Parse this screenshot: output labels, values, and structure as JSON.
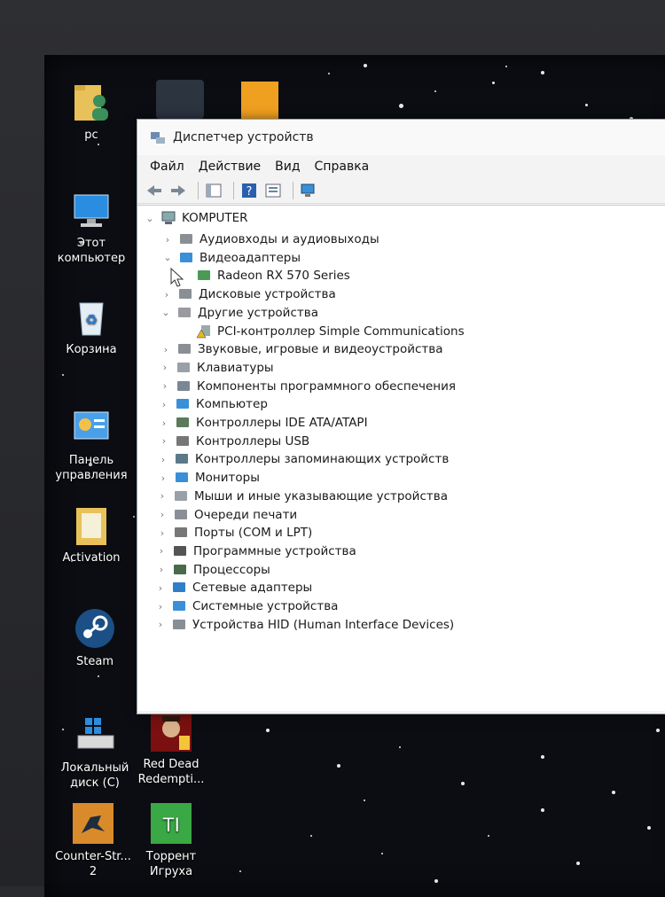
{
  "desktop": {
    "icons": [
      {
        "name": "pc-folder-icon",
        "label": "pc"
      },
      {
        "name": "computer-icon",
        "label": "Этот компьютер"
      },
      {
        "name": "recycle-bin-icon",
        "label": "Корзина"
      },
      {
        "name": "control-panel-icon",
        "label": "Панель управления"
      },
      {
        "name": "activation-folder-icon",
        "label": "Activation"
      },
      {
        "name": "steam-icon",
        "label": "Steam"
      },
      {
        "name": "local-disk-icon",
        "label": "Локальный диск (C)"
      },
      {
        "name": "red-dead-icon",
        "label": "Red Dead Redempti..."
      },
      {
        "name": "counter-strike-icon",
        "label": "Counter-Str... 2"
      },
      {
        "name": "torrent-icon",
        "label": "Торрент Игруха"
      }
    ]
  },
  "window": {
    "title": "Диспетчер устройств",
    "menu": [
      "Файл",
      "Действие",
      "Вид",
      "Справка"
    ],
    "root": "KOMPUTER",
    "tree": [
      {
        "label": "Аудиовходы и аудиовыходы",
        "expanded": false,
        "icon": "audio-icon"
      },
      {
        "label": "Видеоадаптеры",
        "expanded": true,
        "icon": "display-adapter-icon"
      },
      {
        "label": "Radeon RX 570 Series",
        "child": true,
        "icon": "gpu-icon"
      },
      {
        "label": "Дисковые устройства",
        "expanded": false,
        "icon": "disk-icon"
      },
      {
        "label": "Другие устройства",
        "expanded": true,
        "icon": "unknown-device-icon"
      },
      {
        "label": "PCI-контроллер Simple Communications",
        "child": true,
        "icon": "warning-device-icon"
      },
      {
        "label": "Звуковые, игровые и видеоустройства",
        "expanded": false,
        "icon": "sound-icon"
      },
      {
        "label": "Клавиатуры",
        "expanded": false,
        "icon": "keyboard-icon"
      },
      {
        "label": "Компоненты программного обеспечения",
        "expanded": false,
        "icon": "software-component-icon"
      },
      {
        "label": "Компьютер",
        "expanded": false,
        "icon": "computer-icon"
      },
      {
        "label": "Контроллеры IDE ATA/ATAPI",
        "expanded": false,
        "icon": "ide-icon"
      },
      {
        "label": "Контроллеры USB",
        "expanded": false,
        "icon": "usb-icon"
      },
      {
        "label": "Контроллеры запоминающих устройств",
        "expanded": false,
        "icon": "storage-controller-icon"
      },
      {
        "label": "Мониторы",
        "expanded": false,
        "icon": "monitor-icon"
      },
      {
        "label": "Мыши и иные указывающие устройства",
        "expanded": false,
        "icon": "mouse-icon"
      },
      {
        "label": "Очереди печати",
        "expanded": false,
        "icon": "printer-icon"
      },
      {
        "label": "Порты (COM и LPT)",
        "expanded": false,
        "icon": "port-icon"
      },
      {
        "label": "Программные устройства",
        "expanded": false,
        "icon": "software-device-icon"
      },
      {
        "label": "Процессоры",
        "expanded": false,
        "icon": "processor-icon"
      },
      {
        "label": "Сетевые адаптеры",
        "expanded": false,
        "icon": "network-icon"
      },
      {
        "label": "Системные устройства",
        "expanded": false,
        "icon": "system-icon"
      },
      {
        "label": "Устройства HID (Human Interface Devices)",
        "expanded": false,
        "icon": "hid-icon"
      }
    ]
  }
}
